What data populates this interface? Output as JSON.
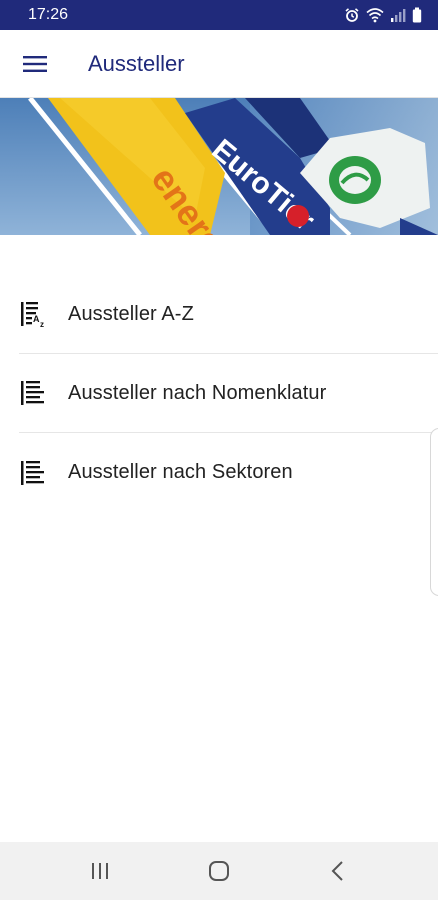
{
  "status_bar": {
    "time": "17:26",
    "icons": [
      "alarm-icon",
      "wifi-icon",
      "signal-icon",
      "battery-icon"
    ]
  },
  "app_bar": {
    "title": "Aussteller",
    "menu_icon": "hamburger-menu-icon"
  },
  "banner": {
    "description_icon": "flags-banner-image"
  },
  "menu": {
    "items": [
      {
        "label": "Aussteller A-Z",
        "icon": "sort-az-list-icon"
      },
      {
        "label": "Aussteller nach Nomenklatur",
        "icon": "list-icon"
      },
      {
        "label": "Aussteller nach Sektoren",
        "icon": "list-icon"
      }
    ]
  },
  "nav_bar": {
    "buttons": [
      "recent-apps-icon",
      "home-icon",
      "back-icon"
    ]
  },
  "colors": {
    "primary": "#202a7b",
    "text": "#222222",
    "divider": "#e6e6e6",
    "nav_bg": "#f1f1f1"
  }
}
